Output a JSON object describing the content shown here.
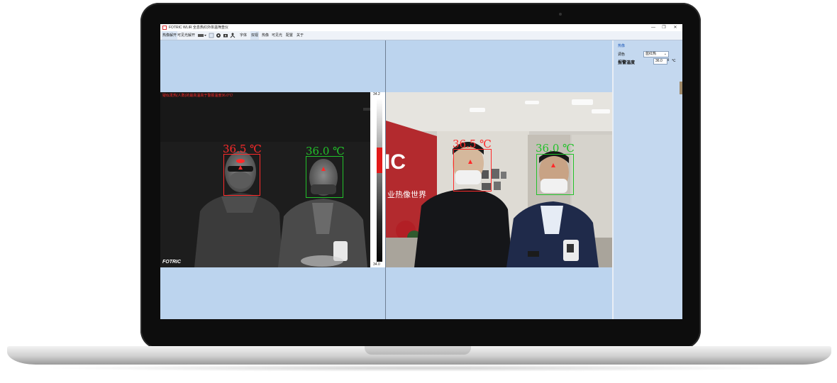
{
  "window": {
    "title": "FOTRIC WLIR 全息热红外体温筛查仪",
    "minimize": "—",
    "maximize": "❐",
    "close": "✕"
  },
  "menu": {
    "items": [
      "热像解开",
      "可见光解开"
    ],
    "right_items": [
      "字体",
      "双视",
      "热像",
      "可见光",
      "配置",
      "关于"
    ]
  },
  "thermal_view": {
    "alert_text": "疑似发热(人数)的最高温高于警报温度36.0℃!",
    "brand": "FOTRIC",
    "scale_max": "34.2",
    "scale_min": "34.0",
    "people": [
      {
        "temp_label": "36.5 ℃",
        "color": "#ff2a2a"
      },
      {
        "temp_label": "36.0 ℃",
        "color": "#22c22a"
      }
    ]
  },
  "visible_view": {
    "people": [
      {
        "temp_label": "36.5 ℃",
        "color": "#ff2a2a"
      },
      {
        "temp_label": "36.0 ℃",
        "color": "#22c22a"
      }
    ]
  },
  "sidebar": {
    "header": "热像",
    "palette_label": "调色",
    "palette_value": "蓝红热",
    "alarm_label": "报警温度",
    "alarm_value": "36.0",
    "alarm_unit": "℃"
  },
  "colors": {
    "screen_bg": "#bcd4ee",
    "alert_red": "#ff2a2a",
    "ok_green": "#22c22a"
  }
}
